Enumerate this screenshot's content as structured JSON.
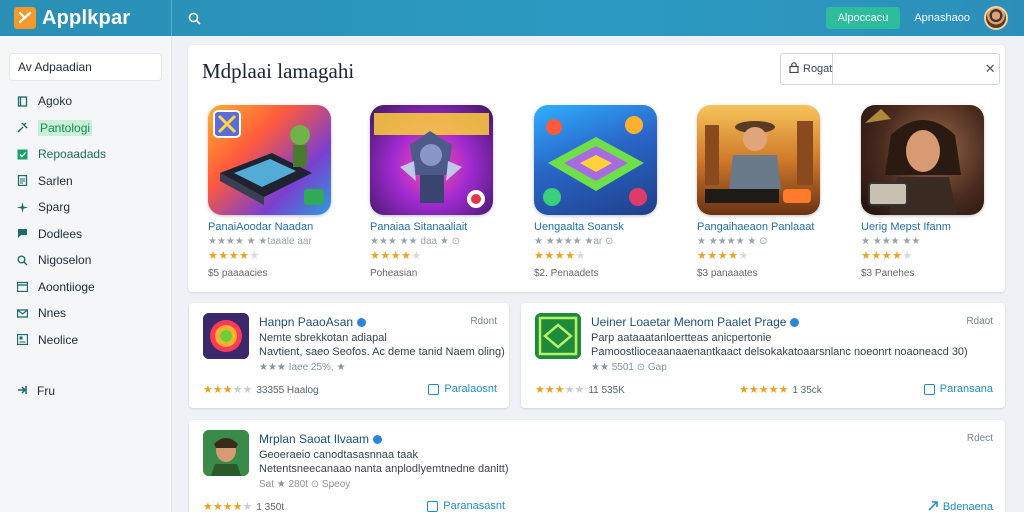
{
  "header": {
    "app_name": "Applkpar",
    "cta_label": "Alpoccacu",
    "account_label": "Apnashaoo"
  },
  "sidebar": {
    "header": "Av Adpaadian",
    "items": [
      {
        "label": "Agoko",
        "icon": "book-icon"
      },
      {
        "label": "Pantologi",
        "icon": "tools-icon",
        "active": true
      },
      {
        "label": "Repoaadads",
        "icon": "grid-icon"
      },
      {
        "label": "Sarlen",
        "icon": "document-icon"
      },
      {
        "label": "Sparg",
        "icon": "sparkle-icon"
      },
      {
        "label": "Dodlees",
        "icon": "chat-icon"
      },
      {
        "label": "Nigoselon",
        "icon": "search-icon"
      },
      {
        "label": "Aoontiioge",
        "icon": "calendar-icon"
      },
      {
        "label": "Nnes",
        "icon": "mail-icon"
      },
      {
        "label": "Neolice",
        "icon": "news-icon"
      }
    ],
    "footer": "Fru"
  },
  "featured": {
    "title": "Mdplaai lamagahi",
    "search_label": "Rogat",
    "search_placeholder": "",
    "tiles": [
      {
        "name": "PanaiAoodar Naadan",
        "sub": "★★★★ ★ ★taaale aar",
        "rating": 4,
        "count": "$5 paaaacies"
      },
      {
        "name": "Panaiaa Sitanaaliait",
        "sub": "★★★ ★★ daa ★ ⊙",
        "rating": 4,
        "count": "Poheasian"
      },
      {
        "name": "Uengaalta Soansk",
        "sub": "★ ★★★★ ★ar ⊙",
        "rating": 4,
        "count": "$2. Penaadets"
      },
      {
        "name": "Pangaihaeaon Panlaaat",
        "sub": "★ ★★★★ ★ ⊙",
        "rating": 4,
        "count": "$3 panaaates"
      },
      {
        "name": "Uerig Mepst Ifanm",
        "sub": "★ ★★★ ★★",
        "rating": 4,
        "count": "$3 Panehes"
      }
    ]
  },
  "cards": [
    {
      "title": "Hanpn PaaoAsan",
      "tag": "Rdont",
      "line1": "Nemte sbrekkotan adiapal",
      "line2": "Navtient, saeo Seofos. Ac deme tanid Naem oling)",
      "meta": "★★★ Iaee 25%, ★",
      "rating": 3,
      "rating_num": "33355 Haalog",
      "action": "Paralaosnt"
    },
    {
      "title": "Ueiner Loaetar Menom Paalet Prage",
      "tag": "Rdaot",
      "line1": "Parp aataaatanloertteas anicpertonie",
      "line2": "Pamoostlioceaanaaenantkaact delsokakatoaarsnlanc noeonrt noaoneacd 30)",
      "meta": "★★ 5501 ⊙ Gap",
      "rating": 3,
      "rating_num": "11 535K",
      "rating2": 5,
      "rating2_num": "1 35ck",
      "action": "Paransana"
    },
    {
      "title": "Mrplan Saoat Ilvaam",
      "tag": "Rdect",
      "line1": "Geoeraeio canodtasasnnaa taak",
      "line2": "Netentsneecanaao nanta anplodlyemtnedne danitt)",
      "meta": "Sat ★ 280t ⊙ Speoy",
      "rating": 4,
      "rating_num": "1 350t",
      "action": "Paranasasnt",
      "action2": "Bdenaena"
    }
  ],
  "colors": {
    "topbar": "#2b95be",
    "accent": "#2dbd9a",
    "link": "#1e8ec0",
    "star": "#f0a020"
  }
}
